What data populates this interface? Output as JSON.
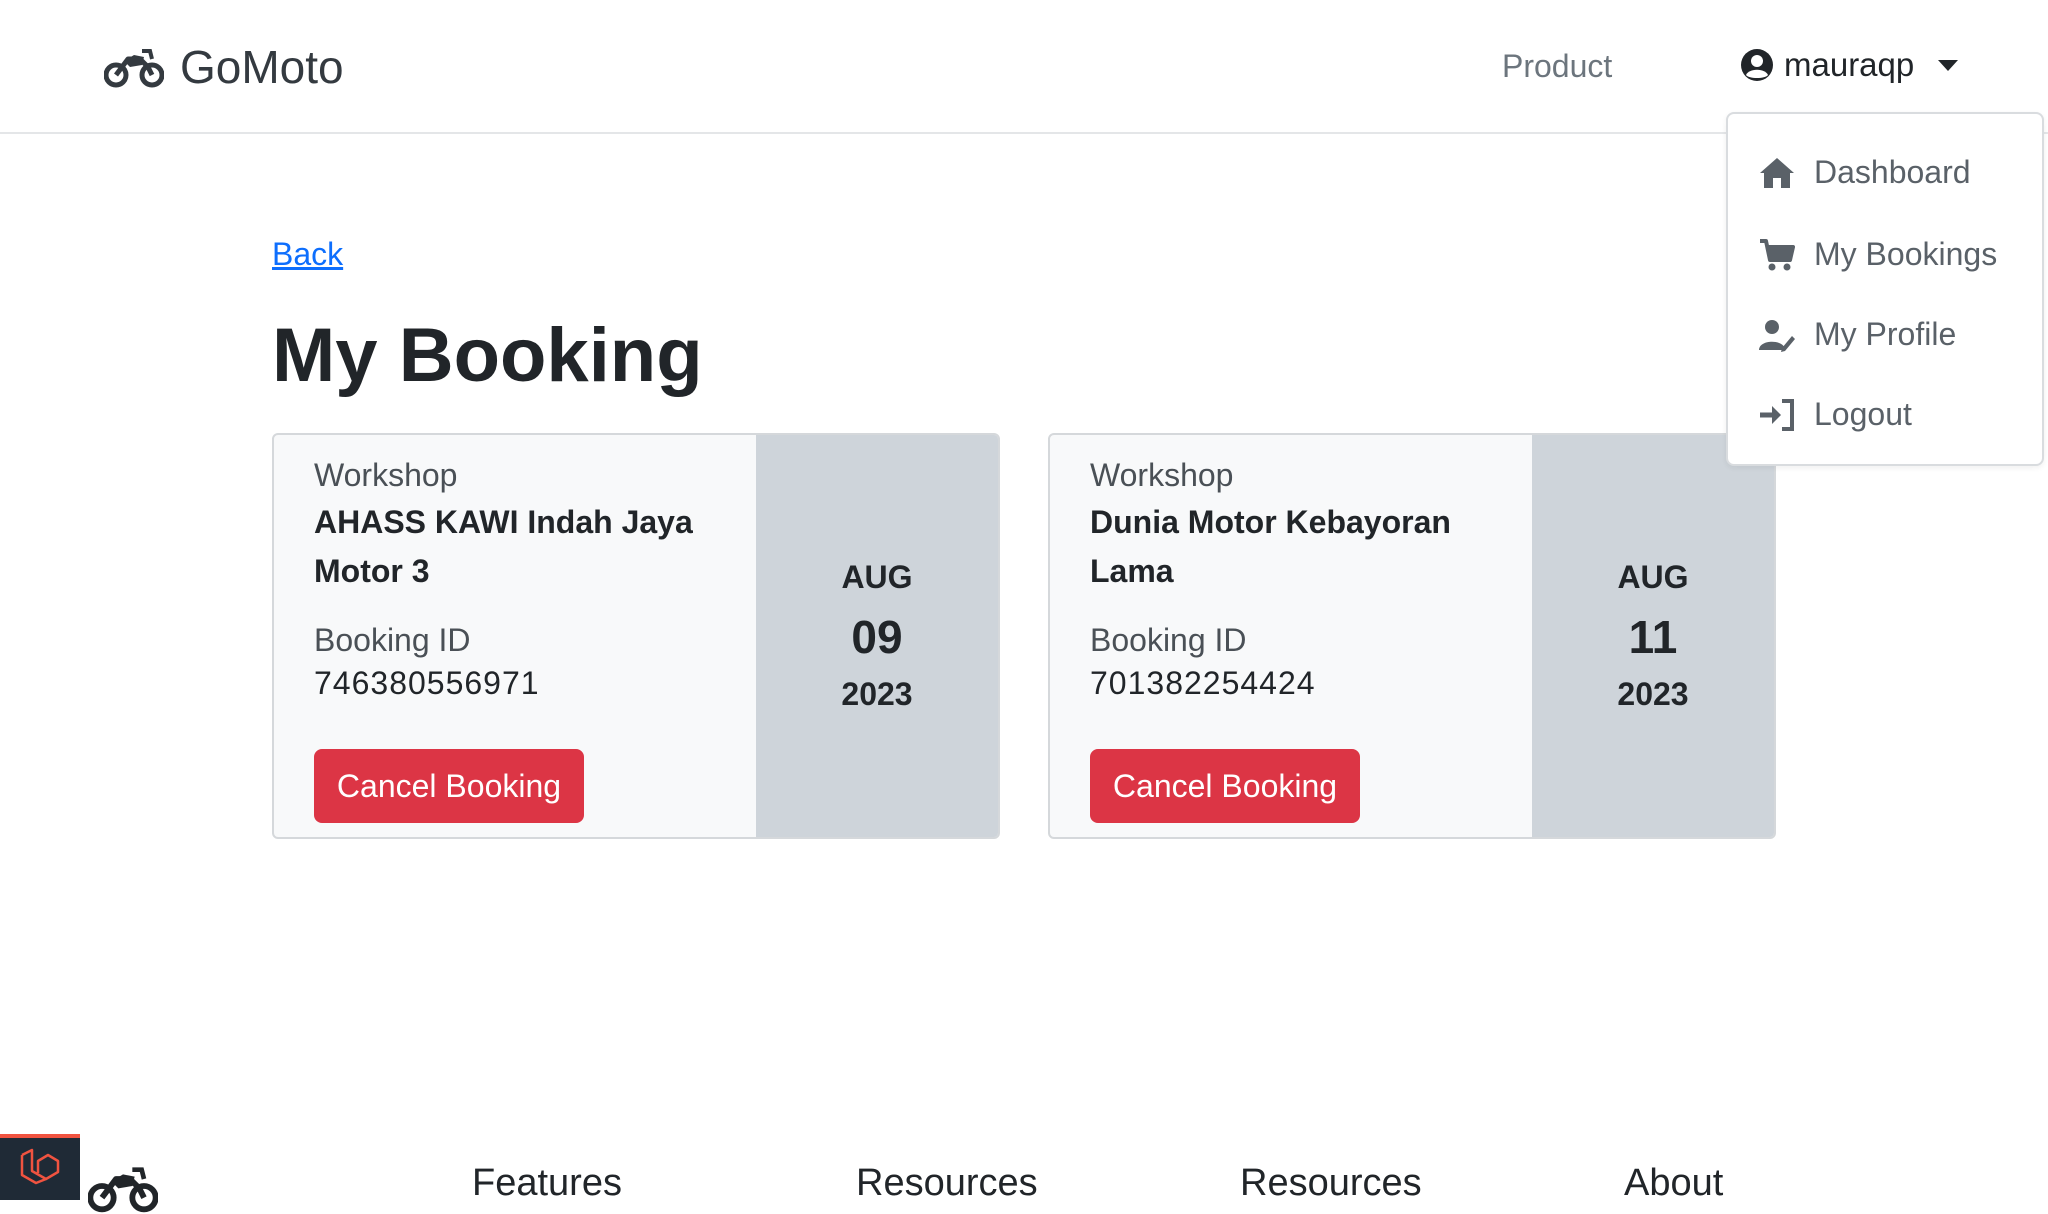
{
  "navbar": {
    "brand": "GoMoto",
    "product_link": "Product",
    "username": "mauraqp"
  },
  "user_menu": {
    "items": [
      {
        "label": "Dashboard",
        "icon": "house-icon"
      },
      {
        "label": "My Bookings",
        "icon": "cart-icon"
      },
      {
        "label": "My Profile",
        "icon": "user-edit-icon"
      },
      {
        "label": "Logout",
        "icon": "sign-in-icon"
      }
    ]
  },
  "main": {
    "back_link": "Back",
    "title": "My Booking"
  },
  "bookings": [
    {
      "workshop_label": "Workshop",
      "workshop_name": "AHASS KAWI Indah Jaya Motor 3",
      "booking_id_label": "Booking ID",
      "booking_id": "746380556971",
      "cancel_label": "Cancel Booking",
      "month": "AUG",
      "day": "09",
      "year": "2023"
    },
    {
      "workshop_label": "Workshop",
      "workshop_name": "Dunia Motor Kebayoran Lama",
      "booking_id_label": "Booking ID",
      "booking_id": "701382254424",
      "cancel_label": "Cancel Booking",
      "month": "AUG",
      "day": "11",
      "year": "2023"
    }
  ],
  "footer": {
    "columns": [
      "Features",
      "Resources",
      "Resources",
      "About"
    ]
  },
  "colors": {
    "danger": "#dc3545",
    "link": "#0d6efd",
    "date_panel": "#ced4da",
    "card_bg": "#f8f9fa"
  }
}
